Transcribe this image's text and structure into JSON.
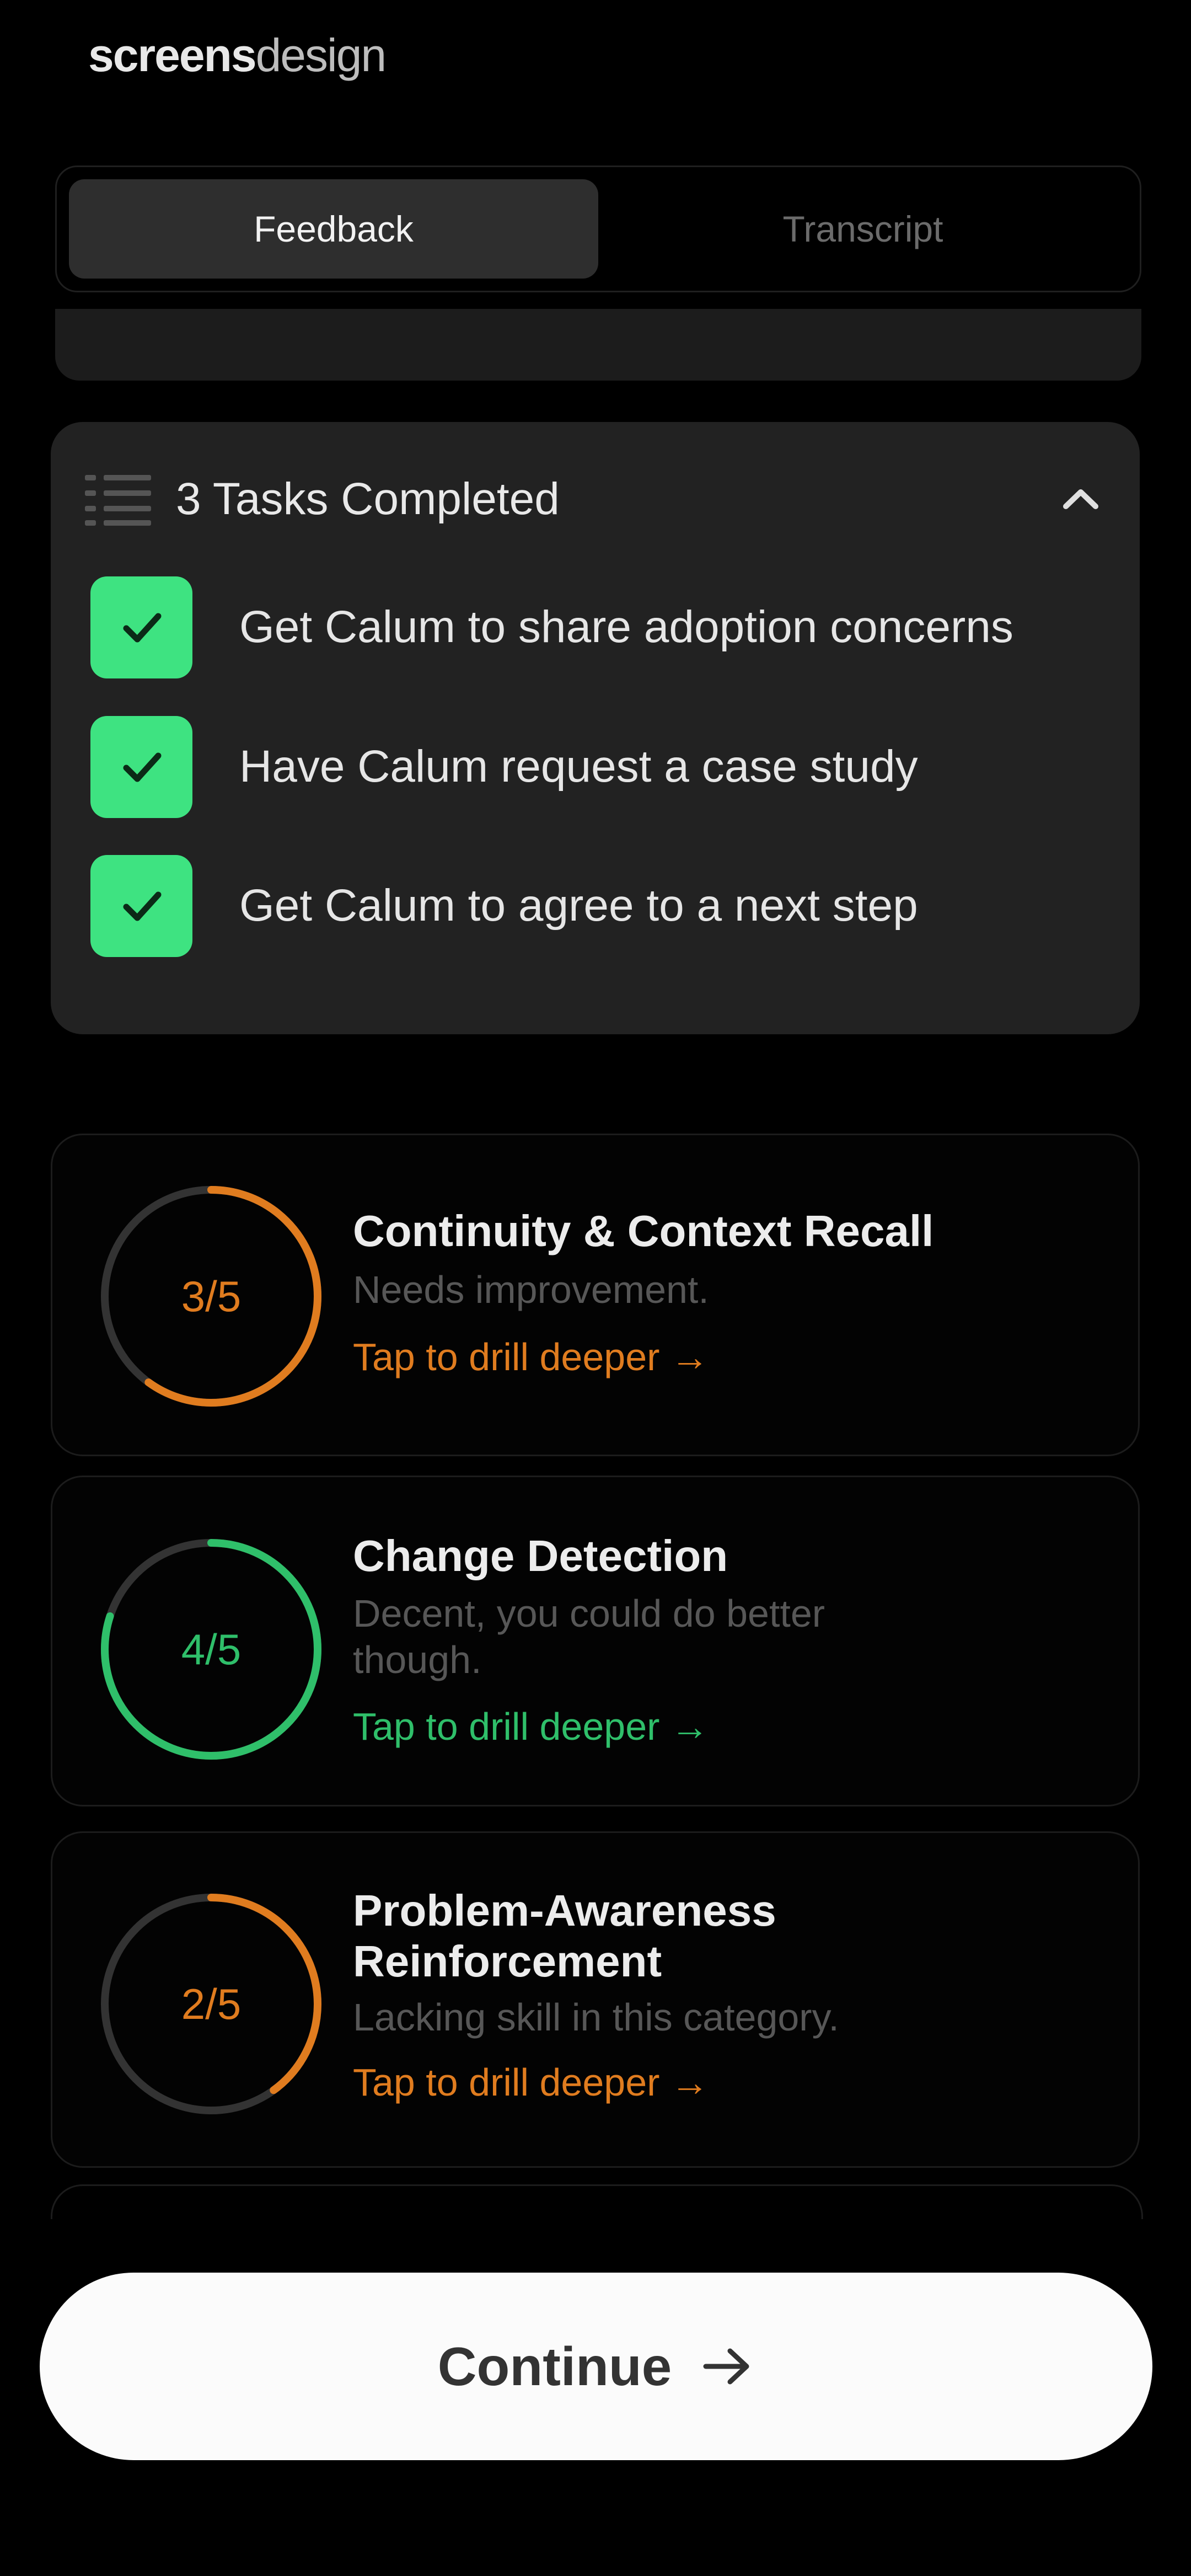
{
  "brand": {
    "bold": "screens",
    "light": "design"
  },
  "tabs": [
    {
      "label": "Feedback",
      "active": true
    },
    {
      "label": "Transcript",
      "active": false
    }
  ],
  "tasks": {
    "title": "3 Tasks Completed",
    "items": [
      {
        "label": "Get Calum to share adoption concerns",
        "done": true
      },
      {
        "label": "Have Calum request a case study",
        "done": true
      },
      {
        "label": "Get Calum to agree to a next step",
        "done": true
      }
    ]
  },
  "metrics": [
    {
      "score_text": "3/5",
      "score": 3,
      "max": 5,
      "color": "#e07c1f",
      "title": "Continuity & Context Recall",
      "description": "Needs improvement.",
      "link": "Tap to drill deeper →"
    },
    {
      "score_text": "4/5",
      "score": 4,
      "max": 5,
      "color": "#2fbf6a",
      "title": "Change Detection",
      "description": "Decent, you could do better though.",
      "link": "Tap to drill deeper →"
    },
    {
      "score_text": "2/5",
      "score": 2,
      "max": 5,
      "color": "#e07c1f",
      "title": "Problem-Awareness Reinforcement",
      "description": "Lacking skill in this category.",
      "link": "Tap to drill deeper →"
    }
  ],
  "continue_button": {
    "label": "Continue"
  },
  "colors": {
    "check": "#3ee381",
    "track": "#333333"
  }
}
